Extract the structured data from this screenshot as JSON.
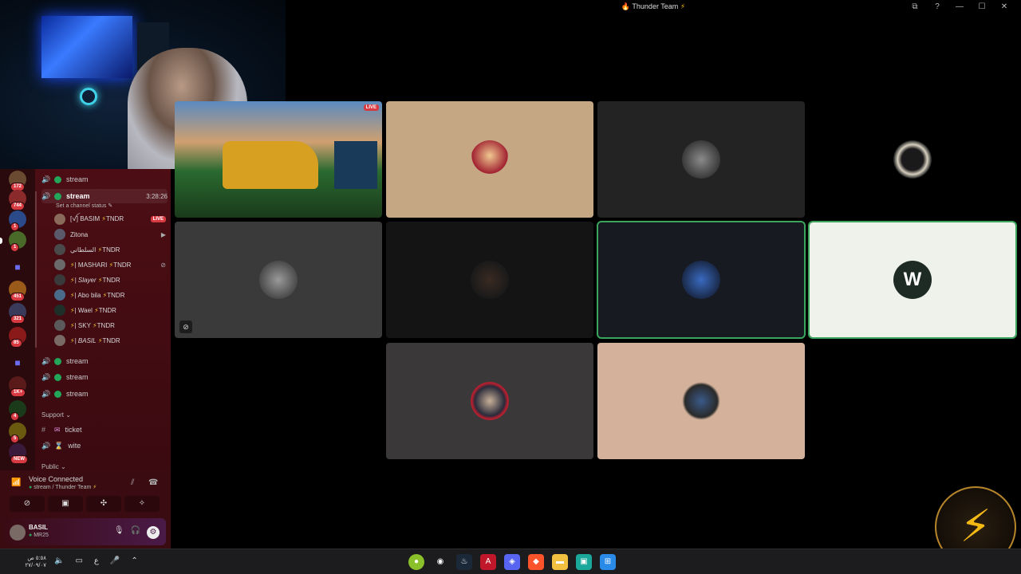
{
  "window": {
    "title": "Thunder Team",
    "title_icon": "thunder-bolt-icon"
  },
  "window_controls": [
    "pip-icon",
    "help-icon",
    "minimize-icon",
    "maximize-icon",
    "close-icon"
  ],
  "server_badges": [
    "172",
    "744",
    "1",
    "1",
    "451",
    "321",
    "85",
    "1K+",
    "4",
    "5",
    "NEW"
  ],
  "channels": {
    "stream_top": "stream",
    "stream_active": "stream",
    "active_time": "3:28:26",
    "status_prompt": "Set a channel status",
    "stream_2": "stream",
    "stream_3": "stream",
    "stream_4": "stream",
    "support_section": "Support",
    "ticket": "ticket",
    "wite": "wite",
    "public_section": "Public"
  },
  "users": [
    {
      "name": "[ꪜ] BASIM",
      "tag": "TNDR",
      "live": "LIVE"
    },
    {
      "name": "Zitona",
      "tag": ""
    },
    {
      "name": "السلطاني",
      "tag": "TNDR"
    },
    {
      "name": "| MASHARI",
      "tag": "TNDR"
    },
    {
      "name": "| Slayer",
      "tag": "TNDR"
    },
    {
      "name": "| Abo bila",
      "tag": "TNDR"
    },
    {
      "name": "| Wael",
      "tag": "TNDR"
    },
    {
      "name": "| SKY",
      "tag": "TNDR"
    },
    {
      "name": "| BASIL",
      "tag": "TNDR"
    }
  ],
  "voice": {
    "status": "Voice Connected",
    "location": "stream / Thunder Team"
  },
  "current_user": {
    "name": "BASIL",
    "subtitle": "MR25"
  },
  "stream_tile": {
    "badge": "LIVE"
  },
  "taskbar": {
    "time": "٥:٥٨ ص",
    "date": "٢٧/٠٩/٠٧",
    "lang": "ع"
  },
  "colors": {
    "accent_online": "#23a55a",
    "live_red": "#d83a42",
    "thunder_gold": "#f5b914"
  }
}
